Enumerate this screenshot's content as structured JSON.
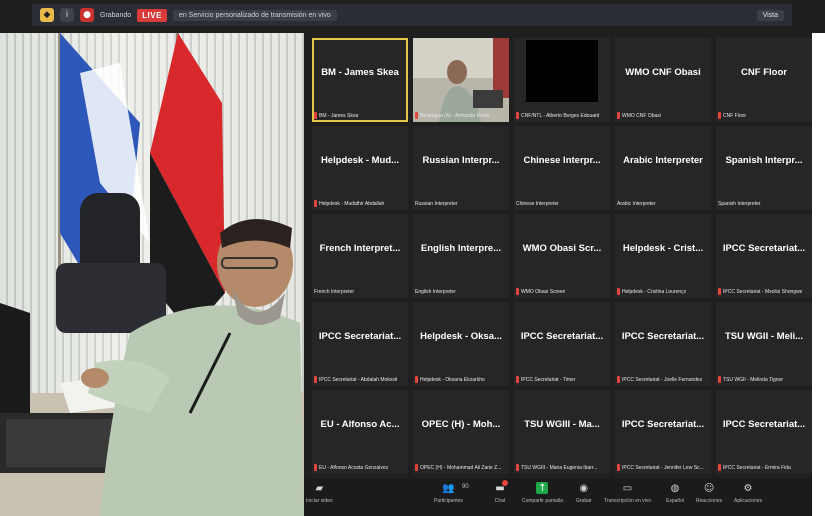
{
  "topbar": {
    "host_label": "Grabando",
    "live_label": "LIVE",
    "stream_label": "en Servicio personalizado de transmisión en vivo",
    "view_label": "Vista"
  },
  "grid": [
    {
      "big": "BM - James Skea",
      "label": "BM - James Skea",
      "active": true,
      "kind": "name",
      "muted": true
    },
    {
      "big": "",
      "label": "Nicaragua (A) - Armando Rossi",
      "active": false,
      "kind": "video",
      "muted": true
    },
    {
      "big": "",
      "label": "CNF/NTL - Alberto Borges Edouard",
      "active": false,
      "kind": "black",
      "muted": true
    },
    {
      "big": "WMO CNF Obasi",
      "label": "WMO CNF Obasi",
      "active": false,
      "kind": "name",
      "muted": true
    },
    {
      "big": "CNF Floor",
      "label": "CNF Floor",
      "active": false,
      "kind": "name",
      "muted": true
    },
    {
      "big": "Helpdesk - Mud...",
      "label": "Helpdesk - Mudathir Abdallah",
      "active": false,
      "kind": "name",
      "muted": true
    },
    {
      "big": "Russian Interpr...",
      "label": "Russian Interpreter",
      "active": false,
      "kind": "name",
      "muted": false
    },
    {
      "big": "Chinese Interpr...",
      "label": "Chinese Interpreter",
      "active": false,
      "kind": "name",
      "muted": false
    },
    {
      "big": "Arabic Interpreter",
      "label": "Arabic Interpreter",
      "active": false,
      "kind": "name",
      "muted": false
    },
    {
      "big": "Spanish Interpr...",
      "label": "Spanish Interpreter",
      "active": false,
      "kind": "name",
      "muted": false
    },
    {
      "big": "French Interpret...",
      "label": "French Interpreter",
      "active": false,
      "kind": "name",
      "muted": false
    },
    {
      "big": "English Interpre...",
      "label": "English Interpreter",
      "active": false,
      "kind": "name",
      "muted": false
    },
    {
      "big": "WMO Obasi Scr...",
      "label": "WMO Obasi Screen",
      "active": false,
      "kind": "name",
      "muted": true
    },
    {
      "big": "Helpdesk - Crist...",
      "label": "Helpdesk - Cristina Lourenço",
      "active": false,
      "kind": "name",
      "muted": true
    },
    {
      "big": "IPCC Secretariat...",
      "label": "IPCC Secretariat - Mxolisi Shongwe",
      "active": false,
      "kind": "name",
      "muted": true
    },
    {
      "big": "IPCC Secretariat...",
      "label": "IPCC Secretariat - Abdalah Mokssit",
      "active": false,
      "kind": "name",
      "muted": true
    },
    {
      "big": "Helpdesk - Oksa...",
      "label": "Helpdesk - Oksana Ekzarkho",
      "active": false,
      "kind": "name",
      "muted": true
    },
    {
      "big": "IPCC Secretariat...",
      "label": "IPCC Secretariat - Timer",
      "active": false,
      "kind": "name",
      "muted": true
    },
    {
      "big": "IPCC Secretariat...",
      "label": "IPCC Secretariat - Joelle Fernandez",
      "active": false,
      "kind": "name",
      "muted": true
    },
    {
      "big": "TSU WGII - Meli...",
      "label": "TSU WGII - Melinda Tignor",
      "active": false,
      "kind": "name",
      "muted": true
    },
    {
      "big": "EU - Alfonso Ac...",
      "label": "EU - Alfonso Acosta Gonzalvez",
      "active": false,
      "kind": "name",
      "muted": true
    },
    {
      "big": "OPEC (H) - Moh...",
      "label": "OPEC (H) - Mohammad Ali Zarie Z...",
      "active": false,
      "kind": "name",
      "muted": true
    },
    {
      "big": "TSU WGIII - Ma...",
      "label": "TSU WGIII - Maria Eugenia Ibarr...",
      "active": false,
      "kind": "name",
      "muted": true
    },
    {
      "big": "IPCC Secretariat...",
      "label": "IPCC Secretariat - Jennifer Lew Sc...",
      "active": false,
      "kind": "name",
      "muted": true
    },
    {
      "big": "IPCC Secretariat...",
      "label": "IPCC Secretariat - Ermira Fida",
      "active": false,
      "kind": "name",
      "muted": true
    }
  ],
  "toolbar": {
    "video_label": "Iniciar video",
    "participants_label": "Participantes",
    "participants_count": "90",
    "chat_label": "Chat",
    "share_label": "Compartir pantalla",
    "record_label": "Grabar",
    "transcript_label": "Transcripción en vivo",
    "language_label": "Español",
    "reactions_label": "Reacciones",
    "apps_label": "Aplicaciones"
  },
  "icons": {
    "video": "video-camera-icon",
    "participants": "people-icon",
    "chat": "chat-bubble-icon",
    "share": "share-screen-icon",
    "record": "record-icon",
    "transcript": "cc-icon",
    "language": "globe-icon",
    "reactions": "emoji-icon",
    "apps": "apps-icon"
  },
  "colors": {
    "live_red": "#d93a3a",
    "active_border": "#e3c94a",
    "share_green": "#1fa84a"
  }
}
